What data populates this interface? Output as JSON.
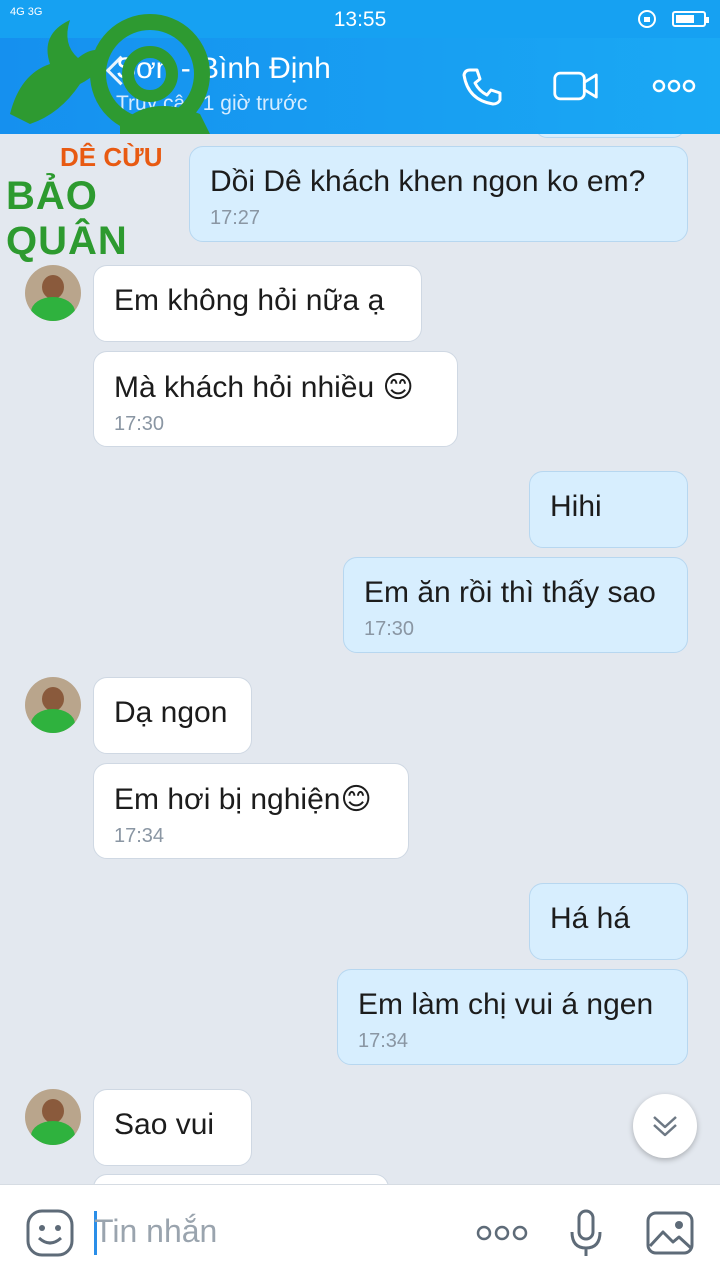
{
  "status": {
    "time": "13:55",
    "signal": "4G 3G"
  },
  "header": {
    "title": "Sơn - Bình Định",
    "subtitle": "Truy cập 1 giờ trước"
  },
  "logo": {
    "line1": "DÊ CỪU",
    "line2": "BẢO QUÂN"
  },
  "messages": [
    {
      "side": "me",
      "text": "Dồi Dê khách khen ngon ko em?",
      "time": "17:27"
    },
    {
      "side": "other",
      "text": "Em không hỏi nữa ạ",
      "time": ""
    },
    {
      "side": "other",
      "text": "Mà khách hỏi nhiều 😊",
      "time": "17:30"
    },
    {
      "side": "me",
      "text": "Hihi",
      "time": ""
    },
    {
      "side": "me",
      "text": "Em ăn rồi thì thấy sao",
      "time": "17:30"
    },
    {
      "side": "other",
      "text": "Dạ ngon",
      "time": ""
    },
    {
      "side": "other",
      "text": "Em hơi bị nghiện😊",
      "time": "17:34"
    },
    {
      "side": "me",
      "text": "Há há",
      "time": ""
    },
    {
      "side": "me",
      "text": "Em làm chị vui á ngen",
      "time": "17:34"
    },
    {
      "side": "other",
      "text": "Sao vui",
      "time": ""
    }
  ],
  "input": {
    "placeholder": "Tin nhắn"
  },
  "icons": [
    "phone-icon",
    "video-icon",
    "more-icon",
    "emoji-icon",
    "mic-icon",
    "image-icon",
    "scroll-down-icon"
  ]
}
